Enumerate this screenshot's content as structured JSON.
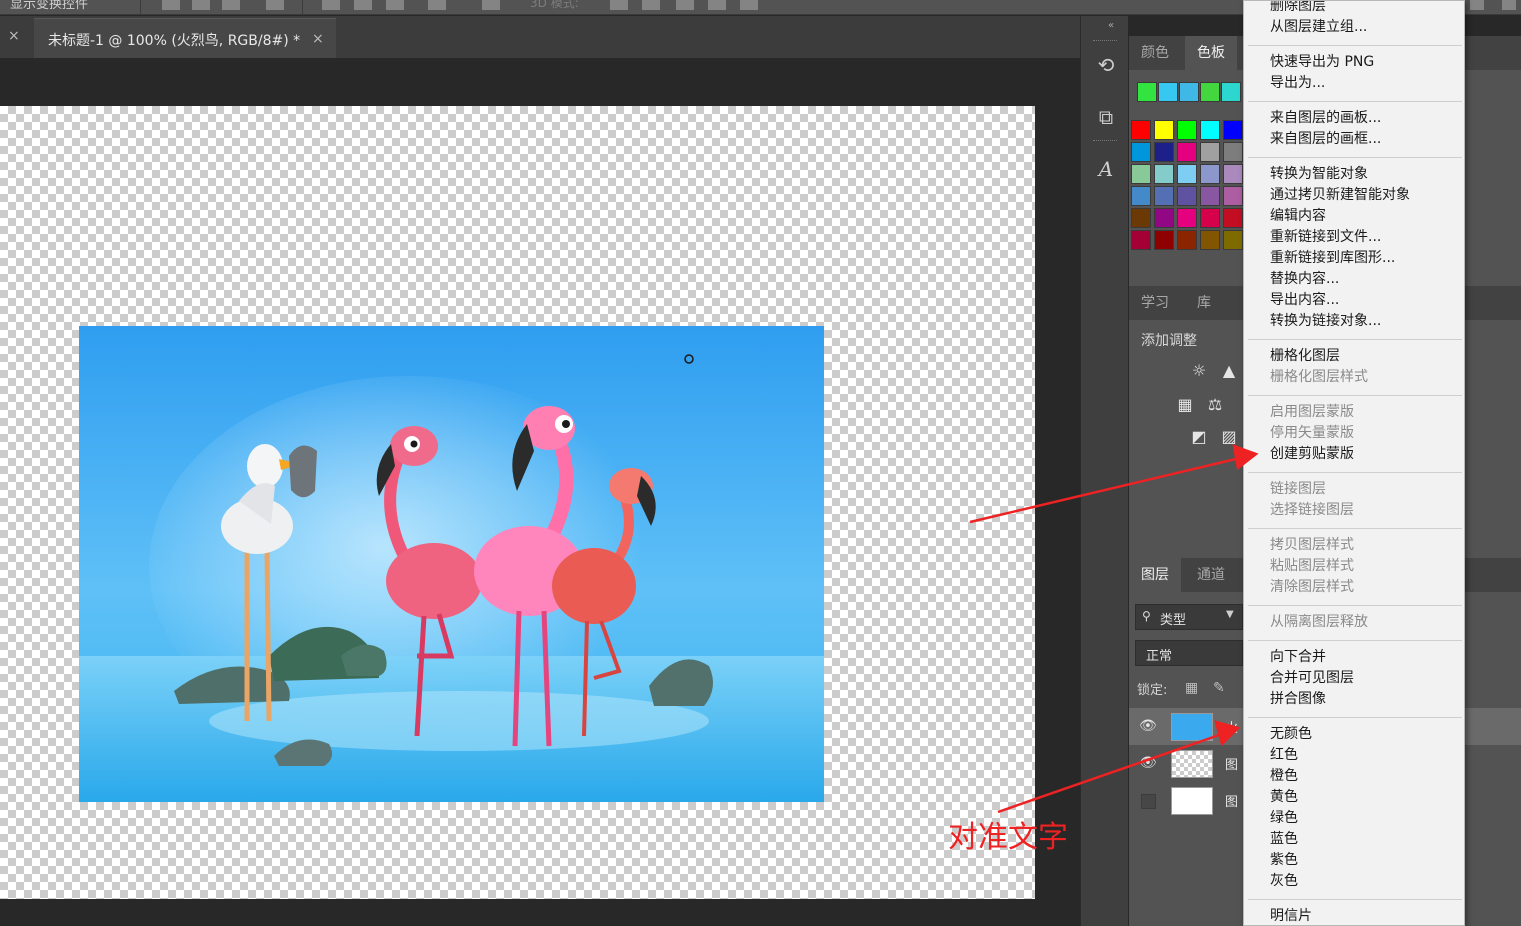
{
  "option_bar": {
    "partial_label": "显示变换控件",
    "mode_3d_label": "3D 模式:"
  },
  "document": {
    "tab_title": "未标题-1 @ 100% (火烈鸟, RGB/8#) *",
    "close_glyph": "×"
  },
  "side_strip": {
    "collapse_glyph": "«",
    "icons": [
      "history-icon",
      "3d-icon",
      "character-icon"
    ]
  },
  "color_panel": {
    "tabs": [
      {
        "label": "颜色",
        "active": false
      },
      {
        "label": "色板",
        "active": true
      }
    ],
    "recent_swatches": [
      "#33e33f",
      "#36c8f0",
      "#3fb8e8",
      "#44d63f",
      "#2bd7cf"
    ],
    "swatch_rows": [
      [
        "#ff0000",
        "#ffff00",
        "#00ff00",
        "#00ffff",
        "#0000ff"
      ],
      [
        "#0096db",
        "#1d2088",
        "#e4007f",
        "#a0a0a0",
        "#7d7d7d"
      ],
      [
        "#89c997",
        "#84ccc9",
        "#7ecef4",
        "#8c97cb",
        "#aa89bd"
      ],
      [
        "#448aca",
        "#556fb5",
        "#5f52a0",
        "#8957a1",
        "#ad5da1"
      ],
      [
        "#6a3906",
        "#920783",
        "#e4007f",
        "#d7004a",
        "#c30d23"
      ],
      [
        "#a40035",
        "#8f0000",
        "#8a2500",
        "#825600",
        "#7e6b00"
      ]
    ]
  },
  "learn_panel": {
    "tabs": [
      {
        "label": "学习",
        "active": false
      },
      {
        "label": "库",
        "active": false
      }
    ],
    "adjustments_title": "添加调整",
    "adjust_icons": [
      "brightness-icon",
      "curves-icon",
      "levels-icon",
      "balance-icon",
      "invert-icon",
      "gradient-map-icon"
    ]
  },
  "layers_panel": {
    "tabs": [
      {
        "label": "图层",
        "active": true
      },
      {
        "label": "通道",
        "active": false
      }
    ],
    "filter_label": "类型",
    "blend_mode": "正常",
    "lock_label": "锁定:",
    "layers": [
      {
        "name": "火",
        "visible": true,
        "selected": true,
        "thumb": "photo"
      },
      {
        "name": "图",
        "visible": true,
        "selected": false,
        "thumb": "checker"
      },
      {
        "name": "图",
        "visible": false,
        "selected": false,
        "thumb": "white"
      }
    ]
  },
  "context_menu": {
    "groups": [
      [
        {
          "label": "删除图层",
          "enabled": true
        },
        {
          "label": "从图层建立组...",
          "enabled": true
        }
      ],
      [
        {
          "label": "快速导出为 PNG",
          "enabled": true
        },
        {
          "label": "导出为...",
          "enabled": true
        }
      ],
      [
        {
          "label": "来自图层的画板...",
          "enabled": true
        },
        {
          "label": "来自图层的画框...",
          "enabled": true
        }
      ],
      [
        {
          "label": "转换为智能对象",
          "enabled": true
        },
        {
          "label": "通过拷贝新建智能对象",
          "enabled": true
        },
        {
          "label": "编辑内容",
          "enabled": true
        },
        {
          "label": "重新链接到文件...",
          "enabled": true
        },
        {
          "label": "重新链接到库图形...",
          "enabled": true
        },
        {
          "label": "替换内容...",
          "enabled": true
        },
        {
          "label": "导出内容...",
          "enabled": true
        },
        {
          "label": "转换为链接对象...",
          "enabled": true
        }
      ],
      [
        {
          "label": "栅格化图层",
          "enabled": true
        },
        {
          "label": "栅格化图层样式",
          "enabled": false
        }
      ],
      [
        {
          "label": "启用图层蒙版",
          "enabled": false
        },
        {
          "label": "停用矢量蒙版",
          "enabled": false
        },
        {
          "label": "创建剪贴蒙版",
          "enabled": true
        }
      ],
      [
        {
          "label": "链接图层",
          "enabled": false
        },
        {
          "label": "选择链接图层",
          "enabled": false
        }
      ],
      [
        {
          "label": "拷贝图层样式",
          "enabled": false
        },
        {
          "label": "粘贴图层样式",
          "enabled": false
        },
        {
          "label": "清除图层样式",
          "enabled": false
        }
      ],
      [
        {
          "label": "从隔离图层释放",
          "enabled": false
        }
      ],
      [
        {
          "label": "向下合并",
          "enabled": true
        },
        {
          "label": "合并可见图层",
          "enabled": true
        },
        {
          "label": "拼合图像",
          "enabled": true
        }
      ],
      [
        {
          "label": "无颜色",
          "enabled": true
        },
        {
          "label": "红色",
          "enabled": true
        },
        {
          "label": "橙色",
          "enabled": true
        },
        {
          "label": "黄色",
          "enabled": true
        },
        {
          "label": "绿色",
          "enabled": true
        },
        {
          "label": "蓝色",
          "enabled": true
        },
        {
          "label": "紫色",
          "enabled": true
        },
        {
          "label": "灰色",
          "enabled": true
        }
      ],
      [
        {
          "label": "明信片",
          "enabled": true
        }
      ]
    ]
  },
  "annotation": {
    "note": "对准文字",
    "color": "#ee2222"
  },
  "colors": {
    "panel_bg": "#535353",
    "menu_bg": "#f2f2f2",
    "workspace_bg": "#282828"
  }
}
